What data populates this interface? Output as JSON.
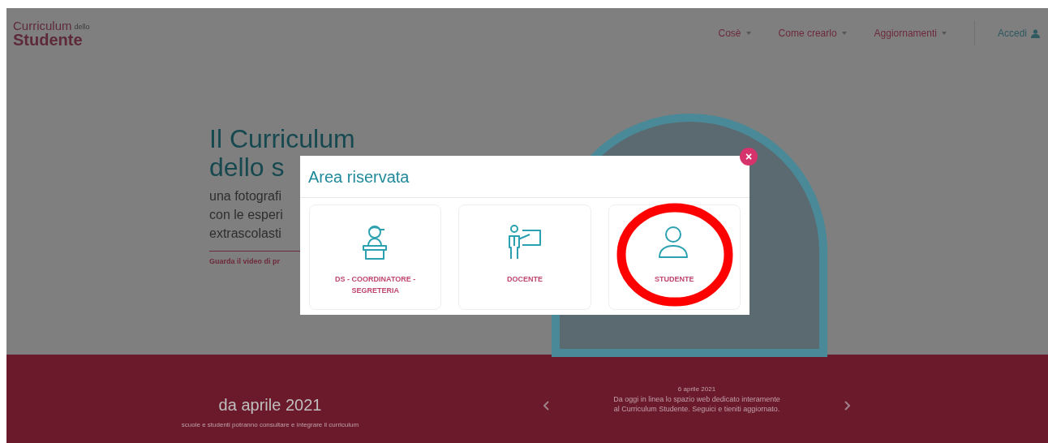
{
  "header": {
    "logo": {
      "line_1": "Curriculum",
      "small": "dello",
      "line_2": "Studente"
    },
    "nav": [
      {
        "label": "Cosè",
        "dropdown": true
      },
      {
        "label": "Come crearlo",
        "dropdown": true
      },
      {
        "label": "Aggiornamenti",
        "dropdown": true
      }
    ],
    "login": {
      "label": "Accedi"
    }
  },
  "hero": {
    "title_lines": [
      "Il Curriculum",
      "dello s"
    ],
    "text_lines": [
      "una fotografi",
      "con le esperi",
      "extrascolasti"
    ],
    "video_link": "Guarda il video di pr"
  },
  "modal": {
    "title": "Area riservata",
    "close": "×",
    "options": [
      {
        "kind": "desk",
        "label": "DS - COORDINATORE - SEGRETERIA",
        "highlighted": false
      },
      {
        "kind": "board",
        "label": "DOCENTE",
        "highlighted": false
      },
      {
        "kind": "user",
        "label": "STUDENTE",
        "highlighted": true
      }
    ]
  },
  "footer": {
    "headline": "da aprile 2021",
    "subline": "scuole e studenti potranno consultare e integrare il curriculum",
    "news": {
      "date": "6 aprile 2021",
      "text_lines": [
        "Da oggi in linea lo spazio web dedicato interamente",
        "al Curriculum Studente. Seguici e tieniti aggiornato."
      ]
    }
  }
}
